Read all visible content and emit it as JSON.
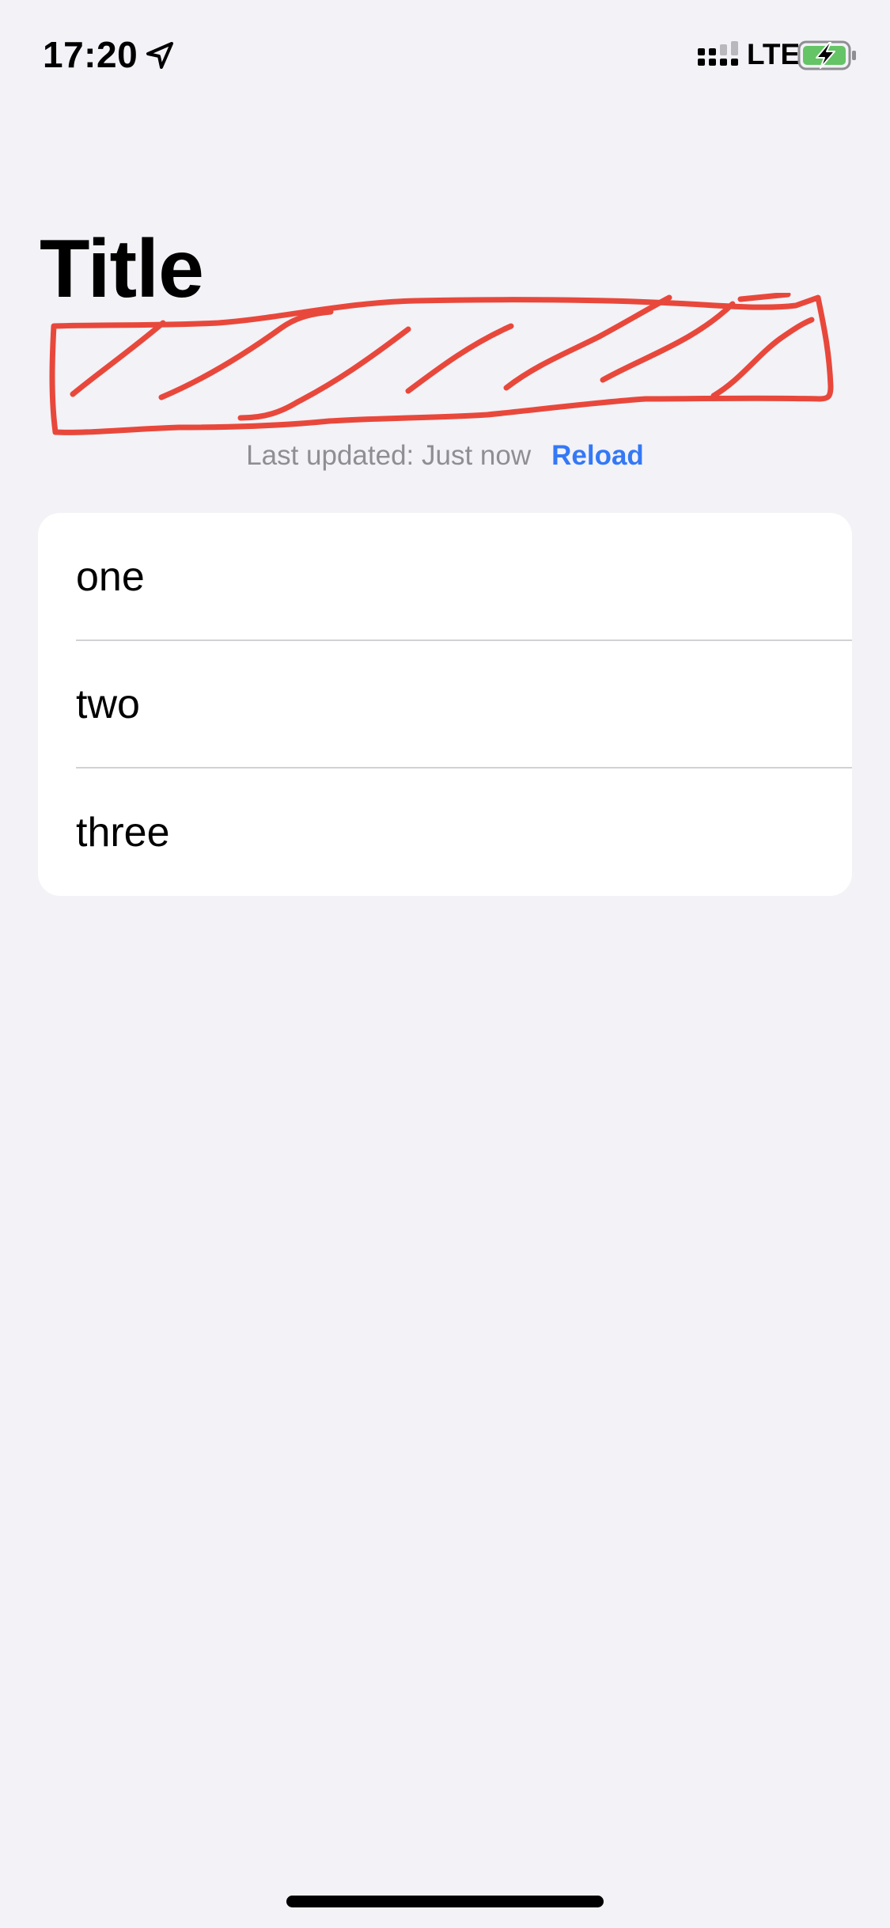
{
  "status_bar": {
    "time": "17:20",
    "network": "LTE",
    "icons": {
      "location": "location-arrow-icon",
      "signal": "cellular-signal-icon",
      "battery": "battery-charging-icon"
    },
    "battery_color": "#65c466"
  },
  "header": {
    "title": "Title"
  },
  "update_info": {
    "text": "Last updated: Just now",
    "reload_label": "Reload"
  },
  "list": {
    "items": [
      {
        "label": "one"
      },
      {
        "label": "two"
      },
      {
        "label": "three"
      }
    ]
  },
  "colors": {
    "background": "#f2f2f7",
    "accent": "#3478f6",
    "secondary_text": "#8e8e93",
    "redaction": "#e8483b"
  }
}
